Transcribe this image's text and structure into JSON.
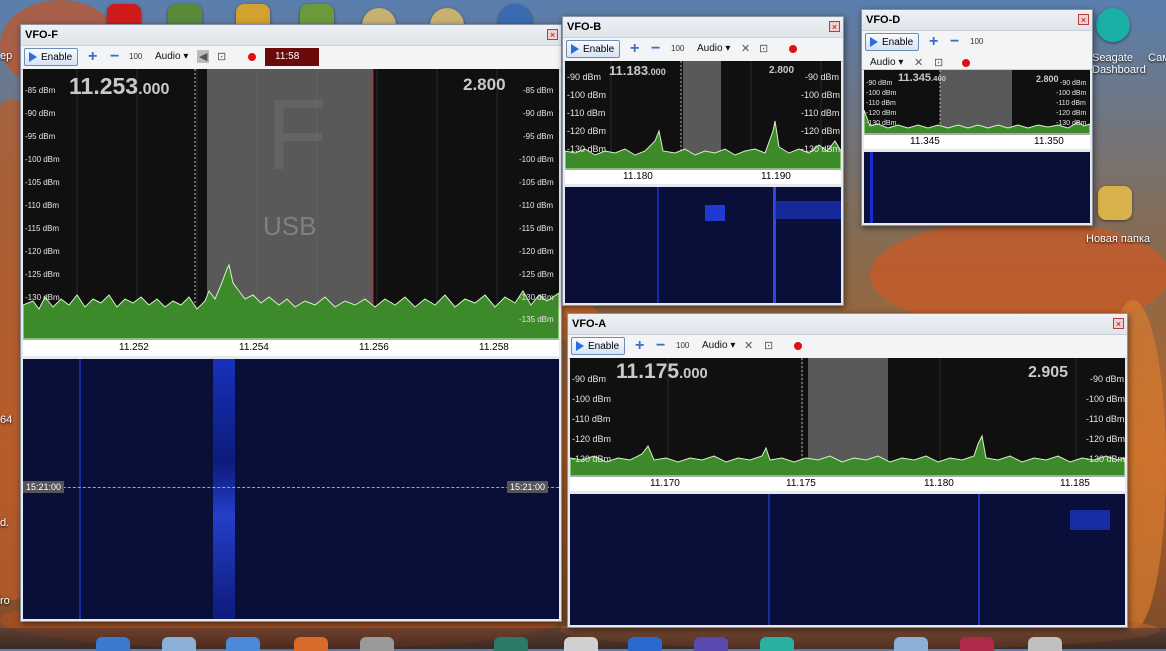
{
  "desktop": {
    "labels": [
      "ер",
      "Seagate Dashboard",
      "Сам",
      "Новая папка",
      "64",
      "d.",
      "ro"
    ]
  },
  "windows": {
    "vfo_f": {
      "title": "VFO-F",
      "enable_label": "Enable",
      "step_label": "100",
      "audio_label": "Audio",
      "time_label": "11:58",
      "freq_main": "11.253",
      "freq_sub": ".000",
      "bandwidth": "2.800",
      "mode_letter": "F",
      "mode_label": "USB",
      "dbm_left": [
        "-85 dBm",
        "-90 dBm",
        "-95 dBm",
        "-100 dBm",
        "-105 dBm",
        "-110 dBm",
        "-115 dBm",
        "-120 dBm",
        "-125 dBm",
        "-130 dBm"
      ],
      "dbm_right": [
        "-85 dBm",
        "-90 dBm",
        "-95 dBm",
        "-100 dBm",
        "-105 dBm",
        "-110 dBm",
        "-115 dBm",
        "-120 dBm",
        "-125 dBm",
        "-130 dBm",
        "-135 dBm"
      ],
      "freq_ticks": [
        "11.252",
        "11.254",
        "11.256",
        "11.258"
      ],
      "waterfall_time_left": "15:21:00",
      "waterfall_time_right": "15:21:00"
    },
    "vfo_b": {
      "title": "VFO-B",
      "enable_label": "Enable",
      "step_label": "100",
      "audio_label": "Audio",
      "freq_main": "11.183",
      "freq_sub": ".000",
      "bandwidth": "2.800",
      "dbm_left": [
        "-90 dBm",
        "-100 dBm",
        "-110 dBm",
        "-120 dBm",
        "-130 dBm"
      ],
      "dbm_right": [
        "-90 dBm",
        "-100 dBm",
        "-110 dBm",
        "-120 dBm",
        "-130 dBm"
      ],
      "freq_ticks": [
        "11.180",
        "11.190"
      ]
    },
    "vfo_d": {
      "title": "VFO-D",
      "enable_label": "Enable",
      "step_label": "100",
      "audio_label": "Audio",
      "freq_main": "11.345",
      "freq_sub": ".400",
      "bandwidth": "2.800",
      "dbm_left": [
        "-90 dBm",
        "-100 dBm",
        "-110 dBm",
        "-120 dBm",
        "-130 dBm"
      ],
      "dbm_right": [
        "-90 dBm",
        "-100 dBm",
        "-110 dBm",
        "-120 dBm",
        "-130 dBm"
      ],
      "freq_ticks": [
        "11.345",
        "11.350"
      ]
    },
    "vfo_a": {
      "title": "VFO-A",
      "enable_label": "Enable",
      "step_label": "100",
      "audio_label": "Audio",
      "freq_main": "11.175",
      "freq_sub": ".000",
      "bandwidth": "2.905",
      "dbm_left": [
        "-90 dBm",
        "-100 dBm",
        "-110 dBm",
        "-120 dBm",
        "-130 dBm"
      ],
      "dbm_right": [
        "-90 dBm",
        "-100 dBm",
        "-110 dBm",
        "-120 dBm",
        "-130 dBm"
      ],
      "freq_ticks": [
        "11.170",
        "11.175",
        "11.180",
        "11.185"
      ]
    }
  },
  "colors": {
    "spectrum_bg": "#101010",
    "passband": "#8a8a8a",
    "signal_fill": "#3d8a2a",
    "waterfall_bg": "#0a0f3a",
    "record": "#e01010"
  }
}
